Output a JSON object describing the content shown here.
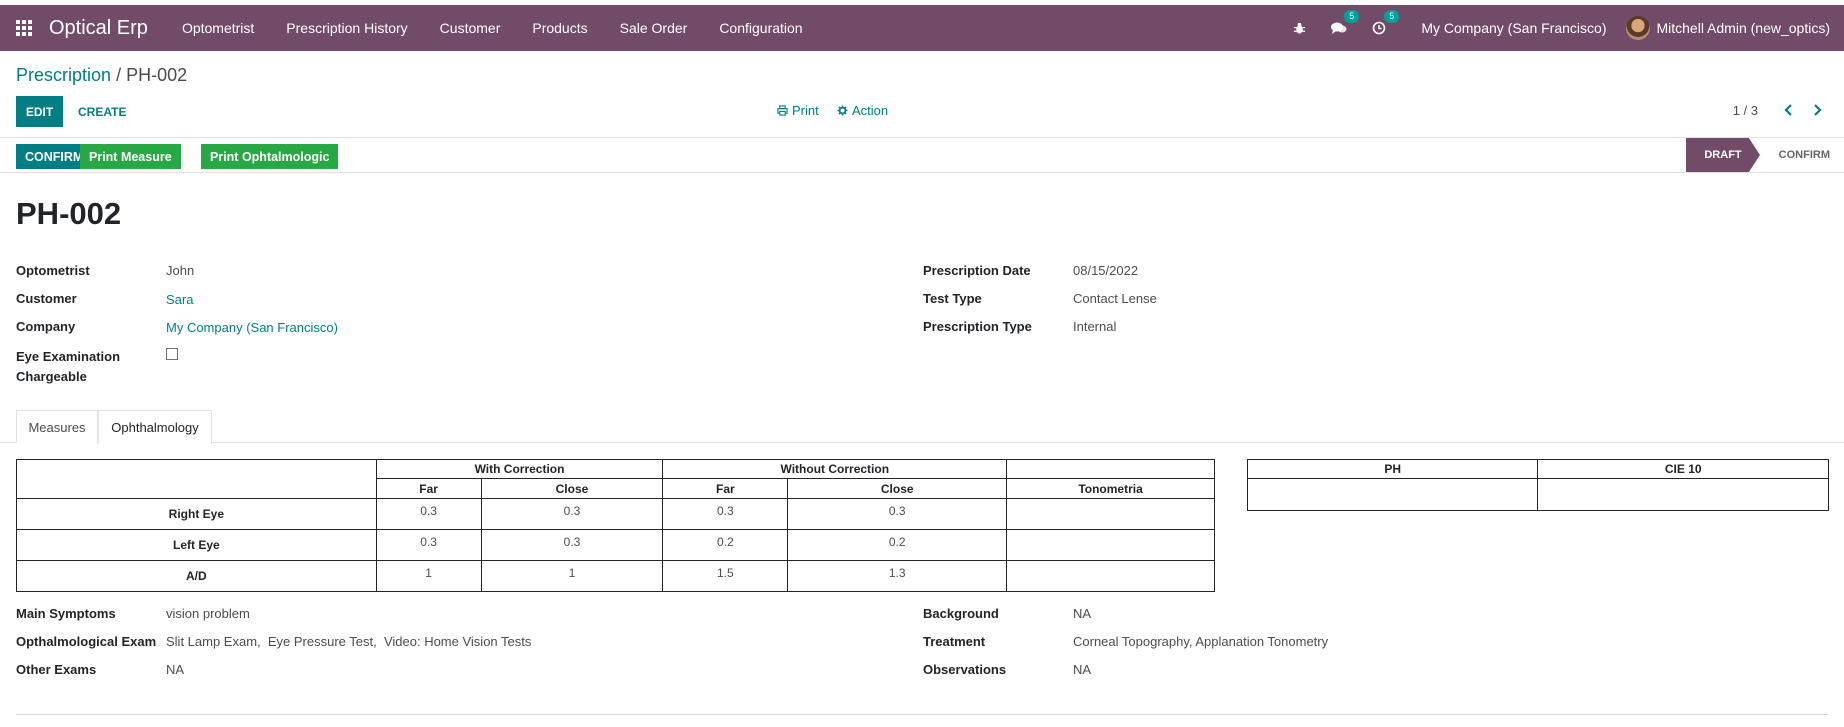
{
  "navbar": {
    "app_name": "Optical Erp",
    "menu": [
      "Optometrist",
      "Prescription History",
      "Customer",
      "Products",
      "Sale Order",
      "Configuration"
    ],
    "messages_count": "5",
    "activities_count": "5",
    "company": "My Company (San Francisco)",
    "user": "Mitchell Admin (new_optics)"
  },
  "control_panel": {
    "breadcrumb_parent": "Prescription",
    "breadcrumb_current": "PH-002",
    "edit_label": "EDIT",
    "create_label": "CREATE",
    "print_label": "Print",
    "action_label": "Action",
    "pager": "1 / 3"
  },
  "statusbar": {
    "confirm_label": "CONFIRM",
    "print_measure_label": "Print Measure",
    "print_ophtal_label": "Print Ophtalmologic",
    "stages": [
      "DRAFT",
      "CONFIRM"
    ],
    "active_stage": "DRAFT"
  },
  "record": {
    "name": "PH-002",
    "left_fields": [
      {
        "label": "Optometrist",
        "value": "John"
      },
      {
        "label": "Customer",
        "value": "Sara"
      },
      {
        "label": "Company",
        "value": "My Company (San Francisco)"
      },
      {
        "label": "Eye Examination Chargeable",
        "value": ""
      }
    ],
    "eye_exam_label_line1": "Eye Examination",
    "eye_exam_label_line2": "Chargeable",
    "right_fields": [
      {
        "label": "Prescription Date",
        "value": "08/15/2022"
      },
      {
        "label": "Test Type",
        "value": "Contact Lense"
      },
      {
        "label": "Prescription Type",
        "value": "Internal"
      }
    ]
  },
  "tabs": [
    "Measures",
    "Ophthalmology"
  ],
  "active_tab": "Ophthalmology",
  "correction_table": {
    "group_headers": [
      "With Correction",
      "Without Correction"
    ],
    "sub_headers": [
      "Far",
      "Close",
      "Far",
      "Close",
      "Tonometria"
    ],
    "rows": [
      {
        "label": "Right Eye",
        "values": [
          "0.3",
          "0.3",
          "0.3",
          "0.3",
          ""
        ]
      },
      {
        "label": "Left Eye",
        "values": [
          "0.3",
          "0.3",
          "0.2",
          "0.2",
          ""
        ]
      },
      {
        "label": "A/D",
        "values": [
          "1",
          "1",
          "1.5",
          "1.3",
          ""
        ]
      }
    ]
  },
  "ph_table": {
    "headers": [
      "PH",
      "CIE 10"
    ],
    "values": [
      "",
      ""
    ]
  },
  "exam": {
    "left": [
      {
        "label": "Main Symptoms",
        "value": "vision problem"
      },
      {
        "label": "Opthalmological Exam",
        "value": "Slit Lamp Exam,  Eye Pressure Test,  Video: Home Vision Tests"
      },
      {
        "label": "Other Exams",
        "value": "NA"
      }
    ],
    "right": [
      {
        "label": "Background",
        "value": "NA"
      },
      {
        "label": "Treatment",
        "value": "Corneal Topography, Applanation Tonometry"
      },
      {
        "label": "Observations",
        "value": "NA"
      }
    ]
  }
}
